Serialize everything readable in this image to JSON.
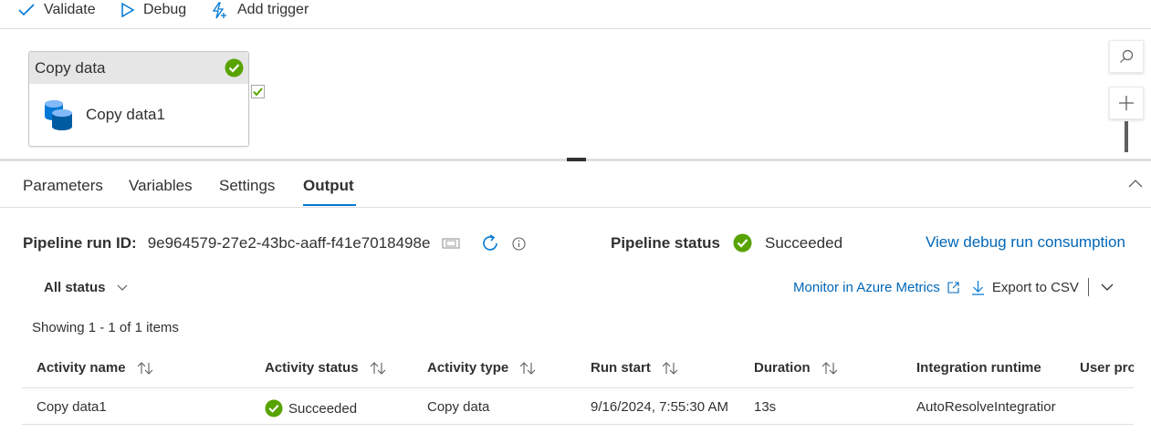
{
  "toolbar": {
    "validate_label": "Validate",
    "debug_label": "Debug",
    "add_trigger_label": "Add trigger"
  },
  "canvas": {
    "activity": {
      "header": "Copy data",
      "name": "Copy data1"
    }
  },
  "tabs": [
    {
      "label": "Parameters"
    },
    {
      "label": "Variables"
    },
    {
      "label": "Settings"
    },
    {
      "label": "Output",
      "active": true
    }
  ],
  "run": {
    "run_id_label": "Pipeline run ID:",
    "run_id": "9e964579-27e2-43bc-aaff-f41e7018498e",
    "status_label": "Pipeline status",
    "status": "Succeeded",
    "consumption_link": "View debug run consumption"
  },
  "filter": {
    "status_filter": "All status"
  },
  "actions": {
    "monitor_link": "Monitor in Azure Metrics",
    "export_label": "Export to CSV"
  },
  "showing_text": "Showing 1 - 1 of 1 items",
  "table": {
    "columns": [
      "Activity name",
      "Activity status",
      "Activity type",
      "Run start",
      "Duration",
      "Integration runtime",
      "User pro"
    ],
    "rows": [
      {
        "activity_name": "Copy data1",
        "activity_status": "Succeeded",
        "activity_type": "Copy data",
        "run_start": "9/16/2024, 7:55:30 AM",
        "duration": "13s",
        "integration_runtime": "AutoResolveIntegratior"
      }
    ]
  },
  "colors": {
    "accent": "#0078d4",
    "link": "#0067b8",
    "success": "#57a300"
  },
  "icons": [
    "checkmark-icon",
    "play-icon",
    "trigger-icon",
    "success-icon",
    "database-icon",
    "search-icon",
    "plus-icon",
    "chevron-up-icon",
    "copy-icon",
    "refresh-icon",
    "info-icon",
    "chevron-down-icon",
    "external-link-icon",
    "download-icon",
    "sort-icon"
  ]
}
